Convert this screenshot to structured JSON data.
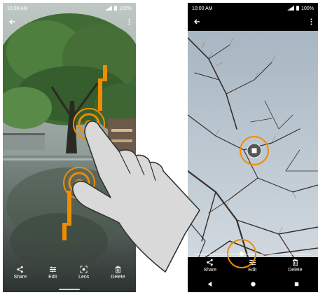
{
  "left_phone": {
    "status_time": "10:00 AM",
    "battery": "100%",
    "actions": [
      {
        "label": "Share",
        "icon": "share-icon"
      },
      {
        "label": "Edit",
        "icon": "edit-sliders-icon"
      },
      {
        "label": "Lens",
        "icon": "lens-icon"
      },
      {
        "label": "Delete",
        "icon": "trash-icon"
      }
    ]
  },
  "right_phone": {
    "status_time": "10:00 AM",
    "battery": "100%",
    "actions": [
      {
        "label": "Share",
        "icon": "share-icon"
      },
      {
        "label": "Edit",
        "icon": "edit-sliders-icon"
      },
      {
        "label": "Delete",
        "icon": "trash-icon"
      }
    ],
    "nav": [
      "back-triangle-icon",
      "home-circle-icon",
      "recents-square-icon"
    ]
  },
  "colors": {
    "gesture_orange": "#f08c00",
    "hand_fill": "#d9d9d9",
    "hand_outline": "#333333",
    "bar_bg": "#000000"
  }
}
